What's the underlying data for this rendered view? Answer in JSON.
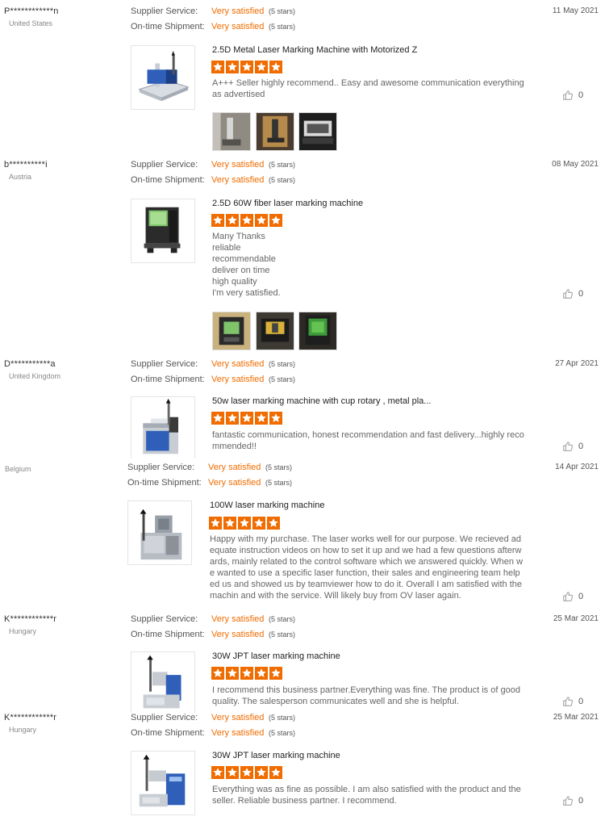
{
  "labels": {
    "supplier_service": "Supplier Service:",
    "ontime_shipment": "On-time Shipment:"
  },
  "reviews": [
    {
      "buyer": "P************n",
      "country": "United States",
      "date": "11 May 2021",
      "supplier_rating": "Very satisfied",
      "supplier_stars": "(5 stars)",
      "shipment_rating": "Very satisfied",
      "shipment_stars": "(5 stars)",
      "product": "2.5D Metal Laser Marking Machine with Motorized Z",
      "rating": 5,
      "text": "A+++ Seller highly recommend.. Easy and awesome communication everything as advertised",
      "likes": "0"
    },
    {
      "buyer": "b**********i",
      "country": "Austria",
      "date": "08 May 2021",
      "supplier_rating": "Very satisfied",
      "supplier_stars": "(5 stars)",
      "shipment_rating": "Very satisfied",
      "shipment_stars": "(5 stars)",
      "product": "2.5D 60W fiber laser marking machine",
      "rating": 5,
      "text": "Many Thanks\nreliable\nrecommendable\ndeliver on time\nhigh quality\nI'm very satisfied.",
      "likes": "0"
    },
    {
      "buyer": "D***********a",
      "country": "United Kingdom",
      "date": "27 Apr 2021",
      "supplier_rating": "Very satisfied",
      "supplier_stars": "(5 stars)",
      "shipment_rating": "Very satisfied",
      "shipment_stars": "(5 stars)",
      "product": "50w laser marking machine with cup rotary , metal pla...",
      "rating": 5,
      "text": "fantastic communication, honest recommendation and fast delivery...highly recommended!!",
      "likes": "0"
    },
    {
      "buyer": "",
      "country": "Belgium",
      "date": "14 Apr 2021",
      "supplier_rating": "Very satisfied",
      "supplier_stars": "(5 stars)",
      "shipment_rating": "Very satisfied",
      "shipment_stars": "(5 stars)",
      "product": "100W laser marking machine",
      "rating": 5,
      "text": "Happy with my purchase. The laser works well for our purpose. We recieved adequate instruction videos on how to set it up and we had a few questions afterwards, mainly related to the control software which we answered quickly. When we wanted to use a specific laser function, their sales and engineering team helped us and showed us by teamviewer how to do it. Overall I am satisfied with the machin and with the service. Will likely buy from OV laser again.",
      "likes": "0"
    },
    {
      "buyer": "K************r",
      "country": "Hungary",
      "date": "25 Mar 2021",
      "supplier_rating": "Very satisfied",
      "supplier_stars": "(5 stars)",
      "shipment_rating": "Very satisfied",
      "shipment_stars": "(5 stars)",
      "product": "30W JPT laser marking machine",
      "rating": 5,
      "text": "I recommend this business partner.Everything was fine. The product is of good quality. The salesperson communicates well and she is helpful.",
      "likes": "0"
    },
    {
      "buyer": "K************r",
      "country": "Hungary",
      "date": "25 Mar 2021",
      "supplier_rating": "Very satisfied",
      "supplier_stars": "(5 stars)",
      "shipment_rating": "Very satisfied",
      "shipment_stars": "(5 stars)",
      "product": "30W JPT laser marking machine",
      "rating": 5,
      "text": "Everything was as fine as possible. I am also satisfied with the product and the seller. Reliable business partner. I recommend.",
      "likes": "0"
    }
  ],
  "colors": {
    "accent": "#f06c00",
    "text": "#333333",
    "muted": "#888888"
  },
  "icons": {
    "star": "star-icon",
    "like": "thumbs-up-icon"
  }
}
